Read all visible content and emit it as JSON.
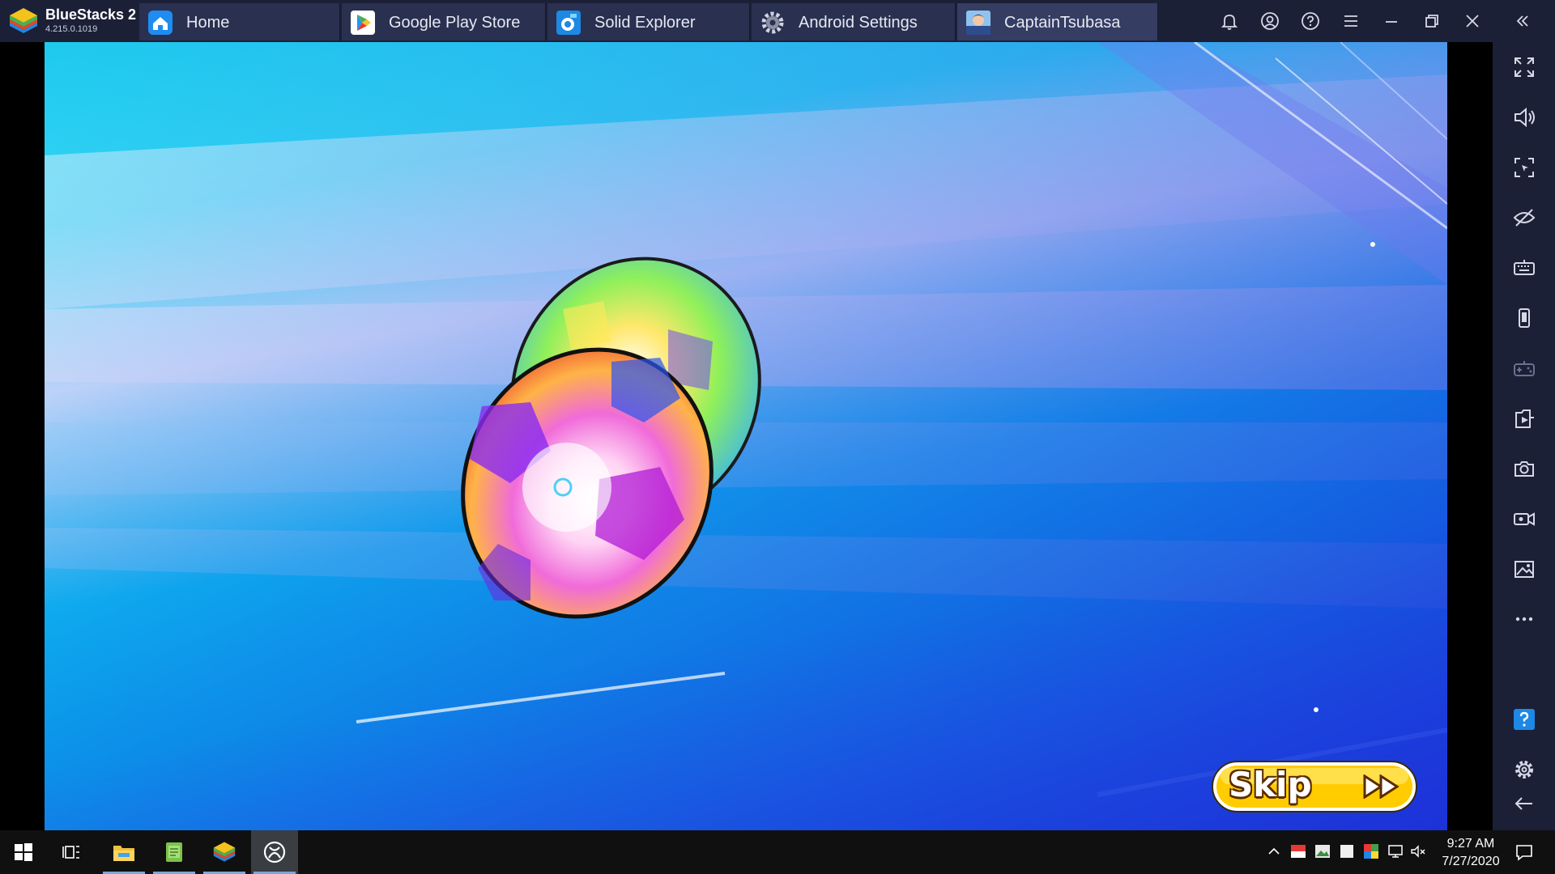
{
  "app": {
    "name": "BlueStacks 2",
    "version": "4.215.0.1019"
  },
  "tabs": [
    {
      "label": "Home",
      "icon": "home-icon",
      "active": false
    },
    {
      "label": "Google Play Store",
      "icon": "play-store-icon",
      "active": false
    },
    {
      "label": "Solid Explorer",
      "icon": "solid-explorer-icon",
      "active": false
    },
    {
      "label": "Android Settings",
      "icon": "settings-gear-icon",
      "active": false
    },
    {
      "label": "CaptainTsubasa",
      "icon": "captain-tsubasa-app-icon",
      "active": true
    }
  ],
  "titlebar_controls": [
    "bell-icon",
    "account-icon",
    "help-icon",
    "menu-icon",
    "minimize-icon",
    "restore-icon",
    "close-icon",
    "collapse-sidebar-icon"
  ],
  "sidebar_tools": [
    "fullscreen-icon",
    "volume-icon",
    "screen-select-icon",
    "eye-off-icon",
    "keyboard-icon",
    "phone-icon",
    "gamepad-icon",
    "install-apk-icon",
    "camera-icon",
    "video-record-icon",
    "media-gallery-icon",
    "more-icon",
    "help-icon",
    "settings-icon",
    "back-icon"
  ],
  "game": {
    "skip_label": "Skip",
    "skip_arrows": "▶▶"
  },
  "taskbar": {
    "apps": [
      "start-icon",
      "task-view-icon",
      "file-explorer-icon",
      "notepad-app-icon",
      "bluestacks-icon",
      "xbox-app-icon"
    ],
    "time": "9:27 AM",
    "date": "7/27/2020"
  },
  "colors": {
    "titlebar": "#1b2036",
    "skip_yellow": "#ffcc00",
    "taskbar": "#101010"
  }
}
